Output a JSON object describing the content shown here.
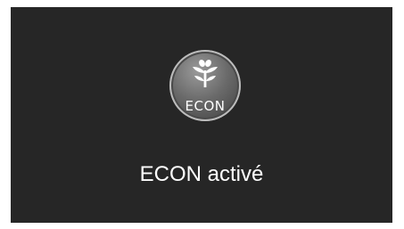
{
  "screen": {
    "badge": {
      "icon": "econ-leaf-icon",
      "label": "ECON"
    },
    "status": "ECON activé"
  },
  "colors": {
    "background": "#262626",
    "text": "#ffffff",
    "badge": "#6a6a6a"
  }
}
